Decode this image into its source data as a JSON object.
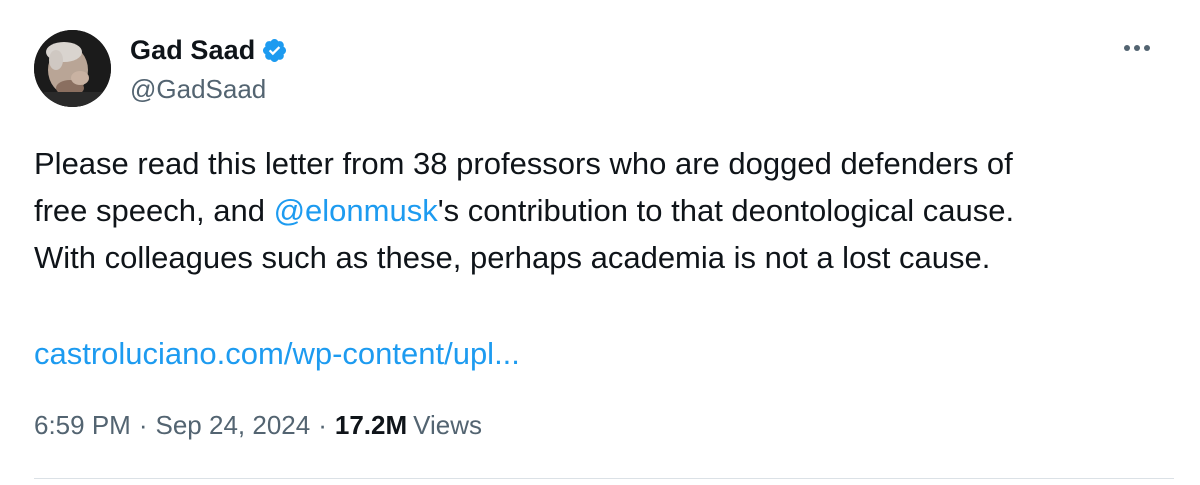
{
  "author": {
    "display_name": "Gad Saad",
    "handle": "@GadSaad",
    "verified": true,
    "verified_color": "#1d9bf0"
  },
  "tweet": {
    "line1": "Please read this letter from 38 professors who are dogged defenders of",
    "line2_before": "free speech, and ",
    "mention": "@elonmusk",
    "line2_after": "'s contribution to that deontological cause.",
    "line3": "With colleagues such as these, perhaps academia is not a lost cause.",
    "link_text": "castroluciano.com/wp-content/upl..."
  },
  "meta": {
    "time": "6:59 PM",
    "separator": "·",
    "date": "Sep 24, 2024",
    "views_count": "17.2M",
    "views_label": "Views"
  },
  "icons": {
    "more": "more-options-icon",
    "verified": "verified-badge-icon"
  },
  "colors": {
    "link": "#1d9bf0",
    "secondary_text": "#536471",
    "primary_text": "#0f1419"
  }
}
